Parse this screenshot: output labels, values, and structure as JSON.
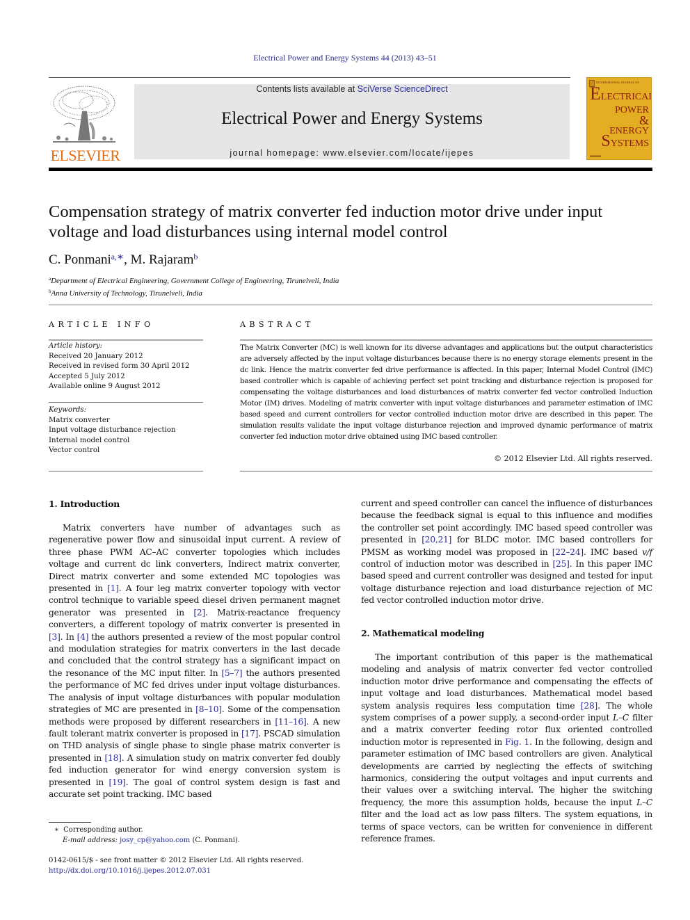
{
  "header": {
    "citation": "Electrical Power and Energy Systems 44 (2013) 43–51",
    "contents_prefix": "Contents lists available at ",
    "contents_link": "SciVerse ScienceDirect",
    "journal_name": "Electrical Power and Energy Systems",
    "homepage_prefix": "journal homepage: ",
    "homepage_url": "www.elsevier.com/locate/ijepes",
    "publisher_logo_text": "ELSEVIER",
    "cover": {
      "top_line": "INTERNATIONAL JOURNAL OF",
      "initial": "E",
      "line1_rest": "LECTRICAL",
      "line2": "POWER",
      "line3": "&",
      "line4": "ENERGY",
      "initial2": "S",
      "line5_rest": "YSTEMS",
      "color": "#e4ae24"
    }
  },
  "article": {
    "title": "Compensation strategy of matrix converter fed induction motor drive under input voltage and load disturbances using internal model control",
    "authors": [
      {
        "name": "C. Ponmani",
        "marks": "a,∗"
      },
      {
        "name": "M. Rajaram",
        "marks": "b"
      }
    ],
    "author_separator": ", ",
    "affiliations": [
      {
        "mark": "a",
        "text": "Department of Electrical Engineering, Government College of Engineering, Tirunelveli, India"
      },
      {
        "mark": "b",
        "text": "Anna University of Technology, Tirunelveli, India"
      }
    ]
  },
  "article_info": {
    "heading": "ARTICLE INFO",
    "history_label": "Article history:",
    "history": [
      "Received 20 January 2012",
      "Received in revised form 30 April 2012",
      "Accepted 5 July 2012",
      "Available online 9 August 2012"
    ],
    "keywords_label": "Keywords:",
    "keywords": [
      "Matrix converter",
      "Input voltage disturbance rejection",
      "Internal model control",
      "Vector control"
    ]
  },
  "abstract": {
    "heading": "ABSTRACT",
    "text": "The Matrix Converter (MC) is well known for its diverse advantages and applications but the output characteristics are adversely affected by the input voltage disturbances because there is no energy storage elements present in the dc link. Hence the matrix converter fed drive performance is affected. In this paper, Internal Model Control (IMC) based controller which is capable of achieving perfect set point tracking and disturbance rejection is proposed for compensating the voltage disturbances and load disturbances of matrix converter fed vector controlled Induction Motor (IM) drives. Modeling of matrix converter with input voltage disturbances and parameter estimation of IMC based speed and current controllers for vector controlled induction motor drive are described in this paper. The simulation results validate the input voltage disturbance rejection and improved dynamic performance of matrix converter fed induction motor drive obtained using IMC based controller.",
    "copyright": "© 2012 Elsevier Ltd. All rights reserved."
  },
  "sections": {
    "intro": {
      "heading": "1. Introduction",
      "segments": [
        {
          "t": "Matrix converters have number of advantages such as regenerative power flow and sinusoidal input current. A review of three phase PWM AC–AC converter topologies which includes voltage and current dc link converters, Indirect matrix converter, Direct matrix converter and some extended MC topologies was presented in "
        },
        {
          "ref": "[1]"
        },
        {
          "t": ". A four leg matrix converter topology with vector control technique to variable speed diesel driven permanent magnet generator was presented in "
        },
        {
          "ref": "[2]"
        },
        {
          "t": ". Matrix-reactance frequency converters, a different topology of matrix converter is presented in "
        },
        {
          "ref": "[3]"
        },
        {
          "t": ". In "
        },
        {
          "ref": "[4]"
        },
        {
          "t": " the authors presented a review of the most popular control and modulation strategies for matrix converters in the last decade and concluded that the control strategy has a significant impact on the resonance of the MC input filter. In "
        },
        {
          "ref": "[5–7]"
        },
        {
          "t": " the authors presented the performance of MC fed drives under input voltage disturbances. The analysis of input voltage disturbances with popular modulation strategies of MC are presented in "
        },
        {
          "ref": "[8–10]"
        },
        {
          "t": ". Some of the compensation methods were proposed by different researchers in "
        },
        {
          "ref": "[11–16]"
        },
        {
          "t": ". A new fault tolerant matrix converter is proposed in "
        },
        {
          "ref": "[17]"
        },
        {
          "t": ". PSCAD simulation on THD analysis of single phase to single phase matrix converter is presented in "
        },
        {
          "ref": "[18]"
        },
        {
          "t": ". A simulation study on matrix converter fed doubly fed induction generator for wind energy conversion system is presented in "
        },
        {
          "ref": "[19]"
        },
        {
          "t": ". The goal of control system design is fast and accurate set point tracking. IMC based"
        }
      ],
      "continuation": [
        {
          "t": "current and speed controller can cancel the influence of disturbances because the feedback signal is equal to this influence and modifies the controller set point accordingly. IMC based speed controller was presented in "
        },
        {
          "ref": "[20,21]"
        },
        {
          "t": " for BLDC motor. IMC based controllers for PMSM as working model was proposed in "
        },
        {
          "ref": "[22–24]"
        },
        {
          "t": ". IMC based "
        },
        {
          "i": "v/f"
        },
        {
          "t": " control of induction motor was described in "
        },
        {
          "ref": "[25]"
        },
        {
          "t": ". In this paper IMC based speed and current controller was designed and tested for input voltage disturbance rejection and load disturbance rejection of MC fed vector controlled induction motor drive."
        }
      ]
    },
    "math": {
      "heading": "2. Mathematical modeling",
      "segments": [
        {
          "t": "The important contribution of this paper is the mathematical modeling and analysis of matrix converter fed vector controlled induction motor drive performance and compensating the effects of input voltage and load disturbances. Mathematical model based system analysis requires less computation time "
        },
        {
          "ref": "[28]"
        },
        {
          "t": ". The whole system comprises of a power supply, a second-order input "
        },
        {
          "i": "L–C"
        },
        {
          "t": " filter and a matrix converter feeding rotor flux oriented controlled induction motor is represented in "
        },
        {
          "ref": "Fig. 1"
        },
        {
          "t": ". In the following, design and parameter estimation of IMC based controllers are given. Analytical developments are carried by neglecting the effects of switching harmonics, considering the output voltages and input currents and their values over a switching interval. The higher the switching frequency, the more this assumption holds, because the input "
        },
        {
          "i": "L–C"
        },
        {
          "t": " filter and the load act as low pass filters. The system equations, in terms of space vectors, can be written for convenience in different reference frames."
        }
      ]
    }
  },
  "footnotes": {
    "corresponding_mark": "∗",
    "corresponding_text": "Corresponding author.",
    "email_label": "E-mail address:",
    "email": "josy_cp@yahoo.com",
    "email_owner": "(C. Ponmani).",
    "front_matter": "0142-0615/$ - see front matter © 2012 Elsevier Ltd. All rights reserved.",
    "doi": "http://dx.doi.org/10.1016/j.ijepes.2012.07.031"
  },
  "colors": {
    "link": "#2a2a9a",
    "elsevier_orange": "#e86c12",
    "banner_grey": "#e6e6e6"
  }
}
